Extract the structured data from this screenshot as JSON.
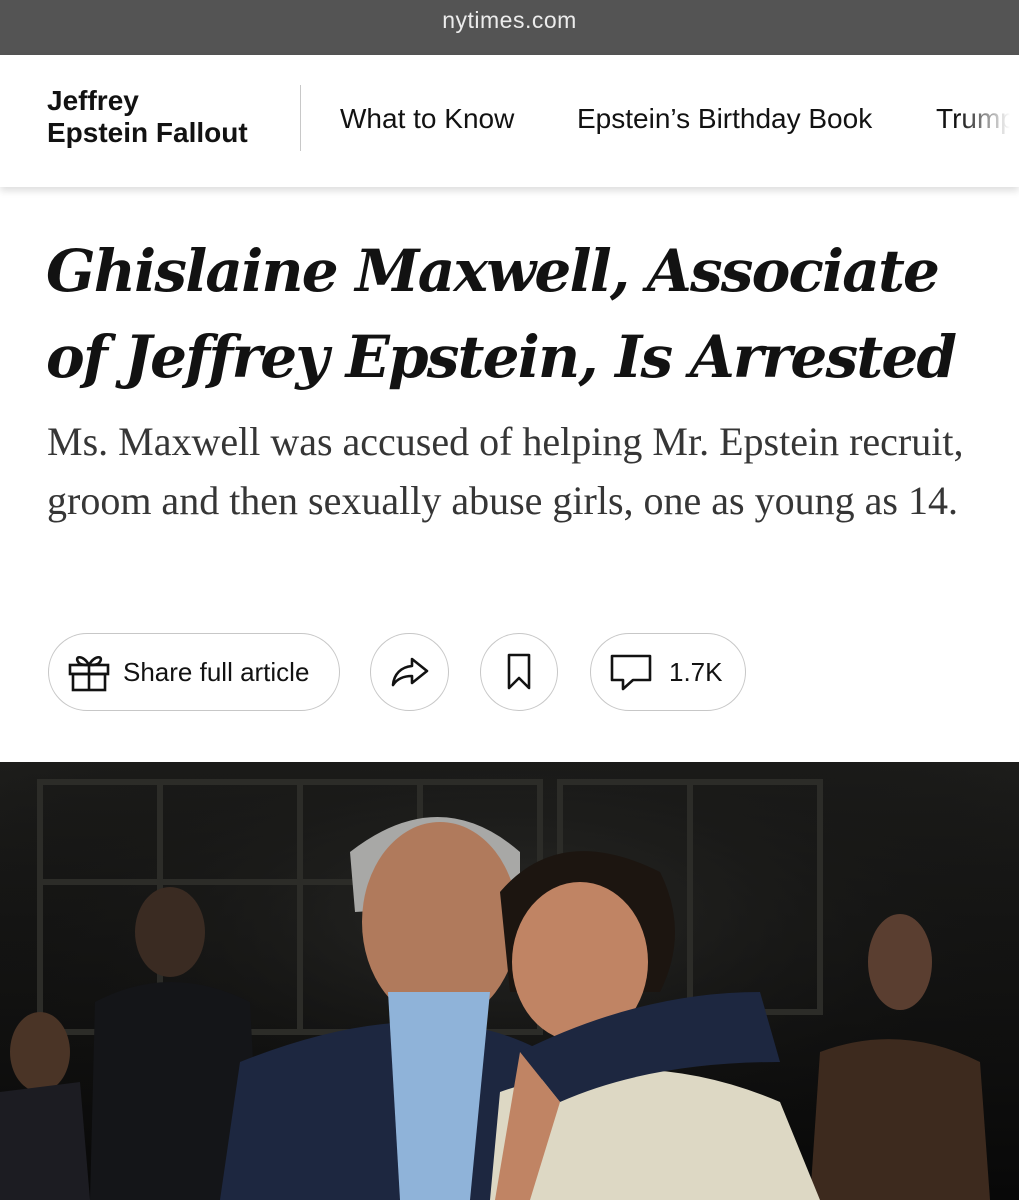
{
  "browser": {
    "url": "nytimes.com"
  },
  "topic_nav": {
    "title_line1": "Jeffrey",
    "title_line2": "Epstein Fallout",
    "items": [
      {
        "label": "What to Know"
      },
      {
        "label": "Epstein’s Birthday Book"
      },
      {
        "label": "Trump"
      }
    ]
  },
  "article": {
    "headline": "Ghislaine Maxwell, Associate of Jeffrey Epstein, Is Arrested",
    "summary": "Ms. Maxwell was accused of helping Mr. Epstein recruit, groom and then sexually abuse girls, one as young as 14."
  },
  "actions": {
    "share_full_label": "Share full article",
    "comment_count": "1.7K",
    "icons": [
      "gift-icon",
      "share-arrow-icon",
      "bookmark-icon",
      "comment-icon"
    ]
  },
  "colors": {
    "url_bar_bg": "#545454",
    "text": "#121212",
    "summary_text": "#363636",
    "button_border": "#c7c7c7"
  }
}
